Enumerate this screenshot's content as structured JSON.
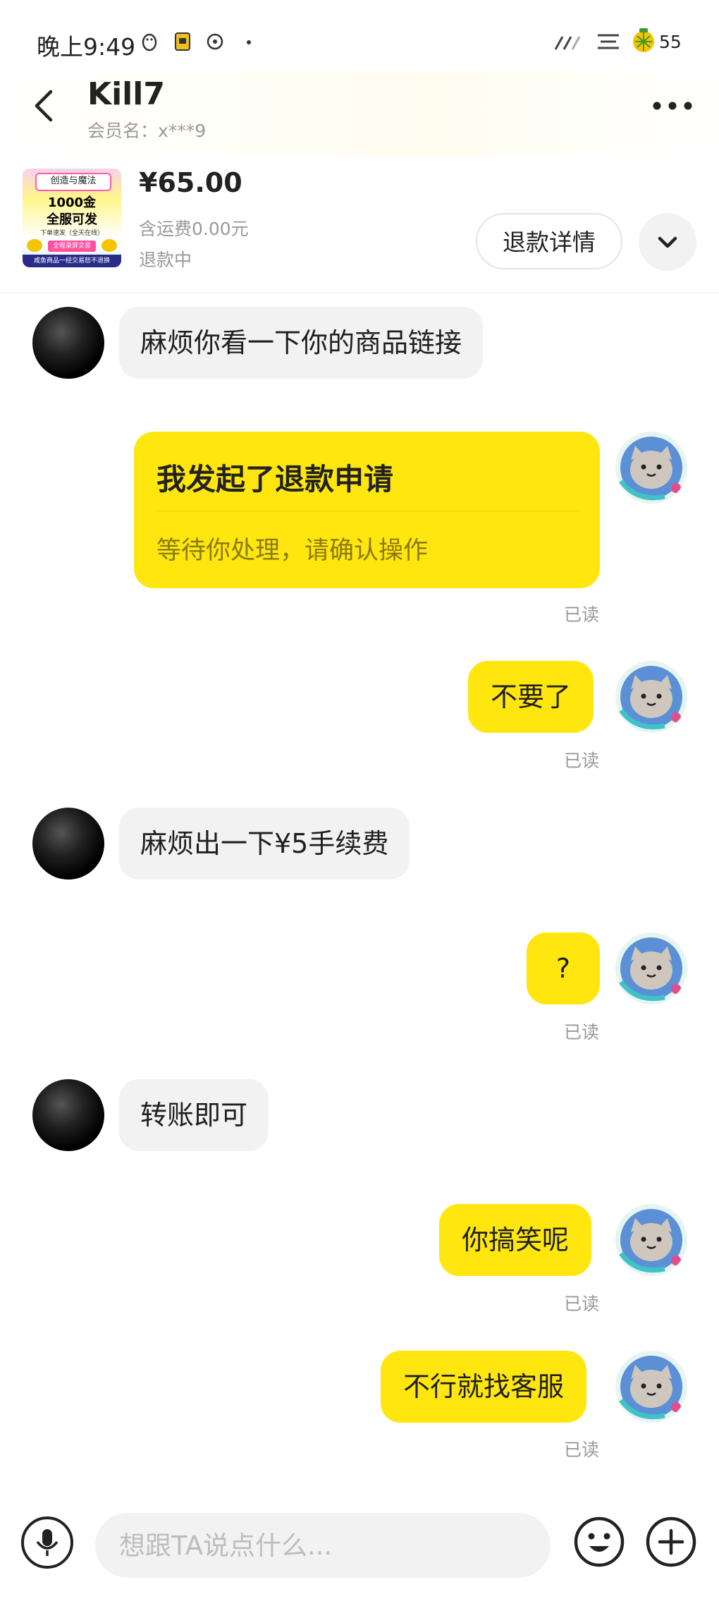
{
  "status_bar": {
    "time": "晚上9:49",
    "battery": "55"
  },
  "header": {
    "name": "Kill7",
    "member": "会员名：x***9"
  },
  "product": {
    "thumb_line1": "创造与魔法",
    "thumb_line2": "1000金",
    "thumb_line3": "全服可发",
    "thumb_line4": "下单速发（全天在线）",
    "thumb_line5": "全程录屏交易",
    "thumb_line6": "咸鱼商品一经交易恕不退换",
    "price": "¥65.00",
    "shipping": "含运费0.00元",
    "status": "退款中",
    "refund_button": "退款详情"
  },
  "messages": [
    {
      "from": "other",
      "text": "麻烦你看一下你的商品链接"
    },
    {
      "from": "me",
      "type": "card",
      "title": "我发起了退款申请",
      "subtitle": "等待你处理，请确认操作",
      "read": "已读"
    },
    {
      "from": "me",
      "text": "不要了",
      "read": "已读"
    },
    {
      "from": "other",
      "text": "麻烦出一下¥5手续费"
    },
    {
      "from": "me",
      "text": "?",
      "read": "已读"
    },
    {
      "from": "other",
      "text": "转账即可"
    },
    {
      "from": "me",
      "text": "你搞笑呢",
      "read": "已读"
    },
    {
      "from": "me",
      "text": "不行就找客服",
      "read": "已读"
    }
  ],
  "input": {
    "placeholder": "想跟TA说点什么..."
  },
  "colors": {
    "my_bubble": "#ffe60f",
    "other_bubble": "#f2f2f2",
    "read_text": "#999999"
  }
}
